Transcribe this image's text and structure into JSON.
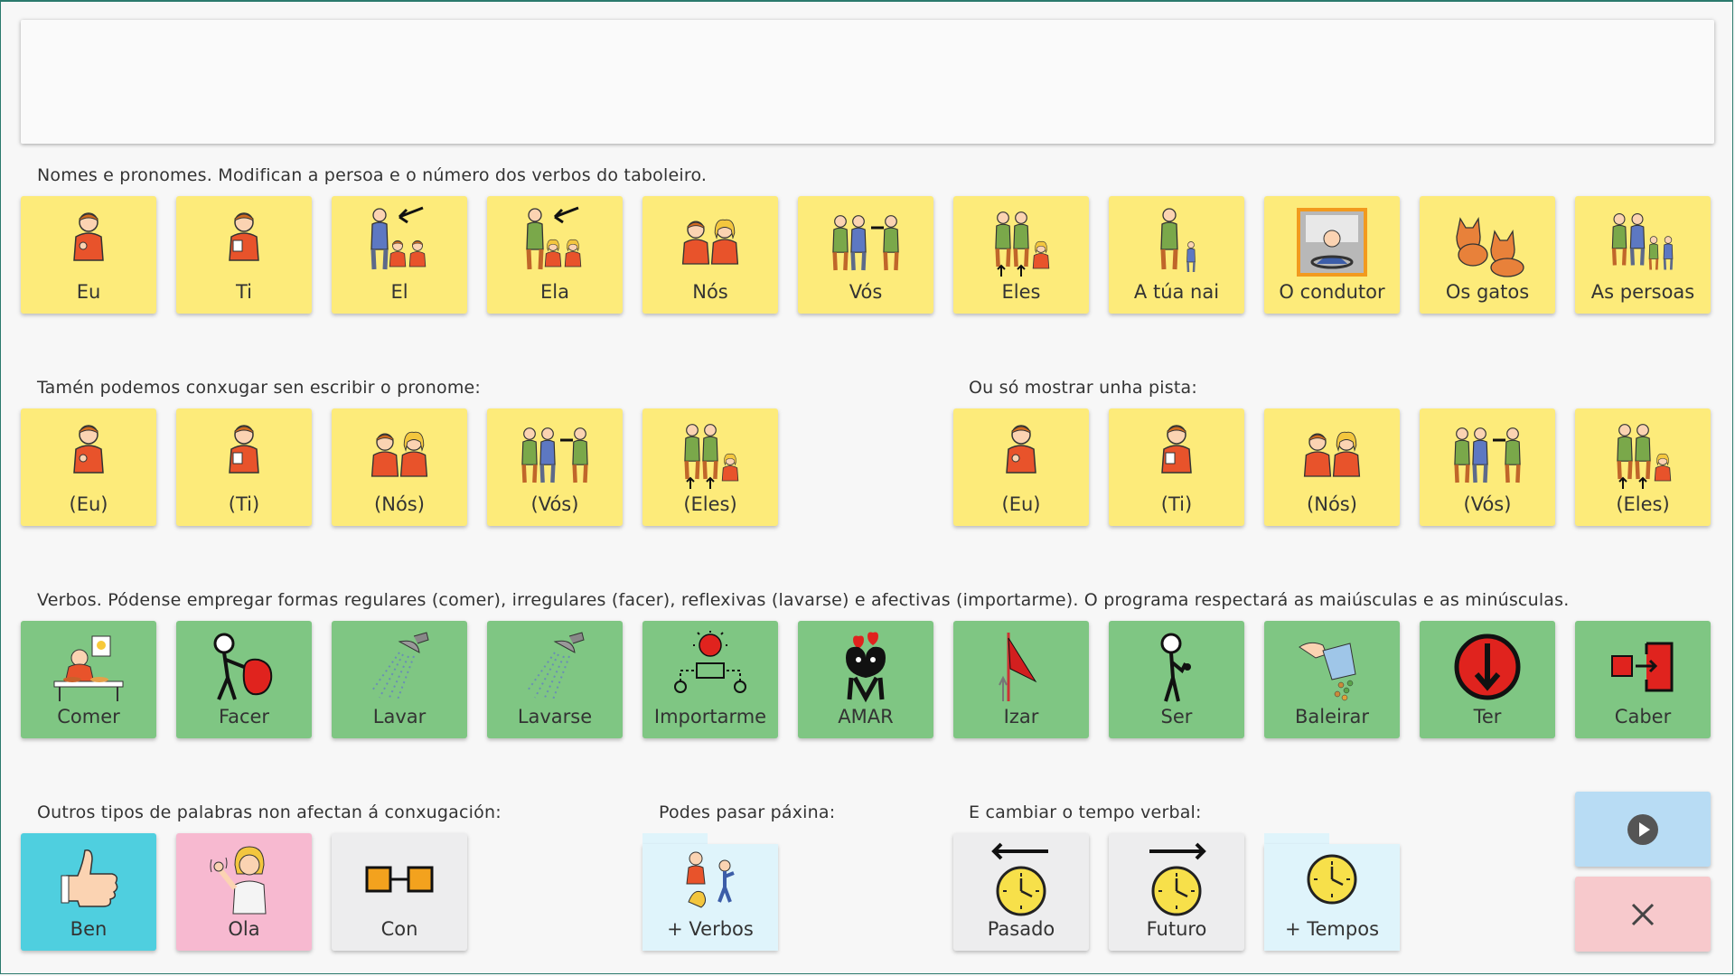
{
  "sections": {
    "pronouns_label": "Nomes e pronomes. Modifican a persoa e o número dos verbos do taboleiro.",
    "implicit_label": "Tamén podemos conxugar sen escribir o pronome:",
    "hint_label": "Ou só mostrar unha pista:",
    "verbs_label": "Verbos. Pódense empregar formas regulares (comer), irregulares (facer), reflexivas (lavarse) e afectivas (importarme). O programa respectará as maiúsculas e as minúsculas.",
    "others_label": "Outros tipos de palabras non afectan á conxugación:",
    "page_label": "Podes pasar páxina:",
    "tense_label": "E cambiar o tempo verbal:"
  },
  "pronouns": [
    "Eu",
    "Ti",
    "El",
    "Ela",
    "Nós",
    "Vós",
    "Eles",
    "A túa nai",
    "O condutor",
    "Os gatos",
    "As persoas"
  ],
  "implicit": [
    "(Eu)",
    "(Ti)",
    "(Nós)",
    "(Vós)",
    "(Eles)"
  ],
  "hints": [
    "(Eu)",
    "(Ti)",
    "(Nós)",
    "(Vós)",
    "(Eles)"
  ],
  "verbs": [
    "Comer",
    "Facer",
    "Lavar",
    "Lavarse",
    "Importarme",
    "AMAR",
    "Izar",
    "Ser",
    "Baleirar",
    "Ter",
    "Caber"
  ],
  "others": [
    "Ben",
    "Ola",
    "Con"
  ],
  "page": [
    "+ Verbos"
  ],
  "tense": [
    "Pasado",
    "Futuro",
    "+ Tempos"
  ],
  "colors": {
    "pronoun_tile": "#fdeb7a",
    "verb_tile": "#7fc683",
    "adverb_tile": "#4fcfdf",
    "social_tile": "#f7b9d0",
    "preposition_tile": "#ededee",
    "folder_tile": "#dff4fb",
    "play_button": "#b8dcf4",
    "clear_button": "#f7c9cc"
  },
  "controls": {
    "play_icon": "play-icon",
    "clear_icon": "close-icon"
  }
}
